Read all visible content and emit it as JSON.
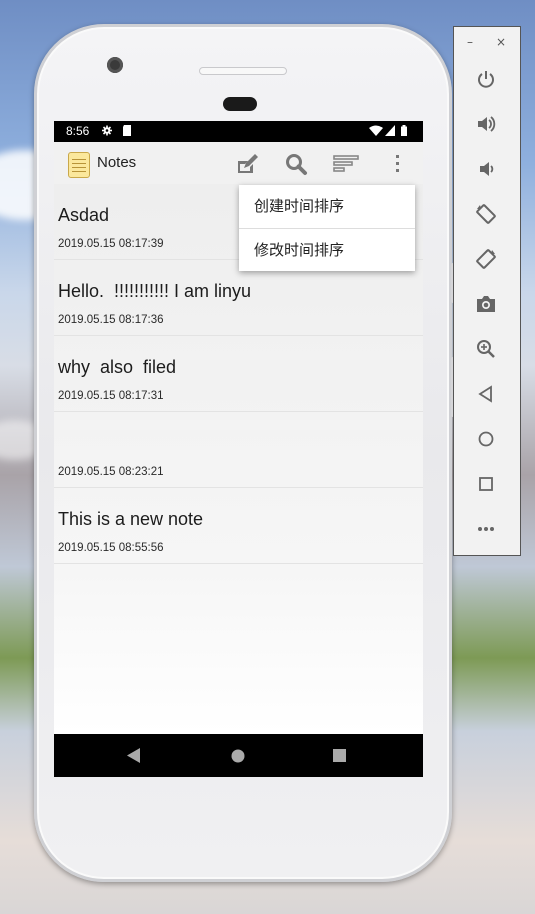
{
  "status_bar": {
    "time": "8:56"
  },
  "app": {
    "title": "Notes"
  },
  "toolbar": {
    "icons": [
      "new-note-icon",
      "search-icon",
      "sort-icon",
      "overflow-menu-icon"
    ]
  },
  "sort_menu": {
    "items": [
      {
        "label": "创建时间排序"
      },
      {
        "label": "修改时间排序"
      }
    ]
  },
  "notes": [
    {
      "title": "Asdad",
      "date": "2019.05.15 08:17:39"
    },
    {
      "title": "Hello.  !!!!!!!!!!! I am linyu",
      "date": "2019.05.15 08:17:36"
    },
    {
      "title": "why  also  filed",
      "date": "2019.05.15 08:17:31"
    },
    {
      "title": "",
      "date": "2019.05.15 08:23:21"
    },
    {
      "title": "This is a new note",
      "date": "2019.05.15 08:55:56"
    }
  ],
  "nav_bar": {
    "icons": [
      "back-icon",
      "home-icon",
      "recents-icon"
    ]
  },
  "emulator_panel": {
    "window_controls": [
      "minimize-icon",
      "close-icon"
    ],
    "icons": [
      "power-icon",
      "volume-up-icon",
      "volume-down-icon",
      "rotate-left-icon",
      "rotate-right-icon",
      "camera-icon",
      "zoom-icon",
      "back-icon",
      "home-icon",
      "overview-icon",
      "more-icon"
    ]
  },
  "colors": {
    "action_bar": "#f1f1f1",
    "status_bar": "#000000",
    "nav_bar": "#000000",
    "emulator_icon": "#666666"
  }
}
